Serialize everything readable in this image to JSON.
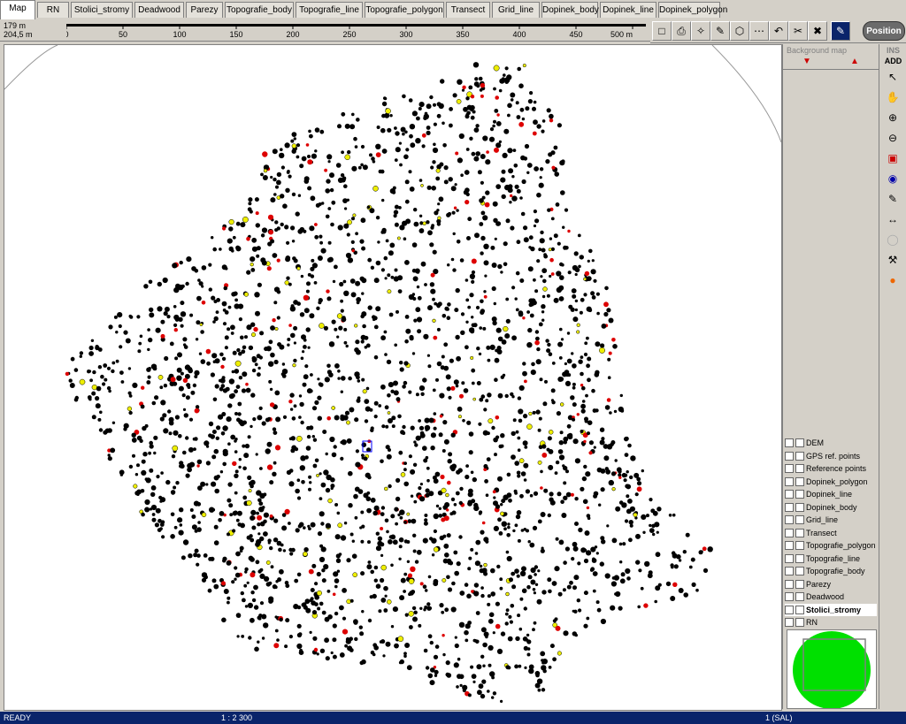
{
  "tabs": [
    "Map",
    "RN",
    "Stolici_stromy",
    "Deadwood",
    "Parezy",
    "Topografie_body",
    "Topografie_line",
    "Topografie_polygon",
    "Transect",
    "Grid_line",
    "Dopinek_body",
    "Dopinek_line",
    "Dopinek_polygon"
  ],
  "scale": {
    "left_top": "179 m",
    "left_bottom": "204,5 m",
    "ticks": [
      "0",
      "50",
      "100",
      "150",
      "200",
      "250",
      "300",
      "350",
      "400",
      "450",
      "500 m"
    ]
  },
  "toolbar": {
    "position_label": "Position"
  },
  "right_panel": {
    "background_label": "Background map",
    "add_label": "ADD",
    "ins_label": "INS"
  },
  "layers": [
    {
      "name": "DEM",
      "checked": false
    },
    {
      "name": "GPS ref. points",
      "checked": true
    },
    {
      "name": "Reference points",
      "checked": true
    },
    {
      "name": "Dopinek_polygon",
      "checked": true
    },
    {
      "name": "Dopinek_line",
      "checked": true
    },
    {
      "name": "Dopinek_body",
      "checked": true
    },
    {
      "name": "Grid_line",
      "checked": true
    },
    {
      "name": "Transect",
      "checked": true
    },
    {
      "name": "Topografie_polygon",
      "checked": true
    },
    {
      "name": "Topografie_line",
      "checked": true
    },
    {
      "name": "Topografie_body",
      "checked": true
    },
    {
      "name": "Parezy",
      "checked": true
    },
    {
      "name": "Deadwood",
      "checked": true
    },
    {
      "name": "Stolici_stromy",
      "checked": true,
      "selected": true
    },
    {
      "name": "RN",
      "checked": true
    }
  ],
  "status": {
    "ready": "READY",
    "scale": "1 : 2 300",
    "right": "1 (SAL)"
  }
}
